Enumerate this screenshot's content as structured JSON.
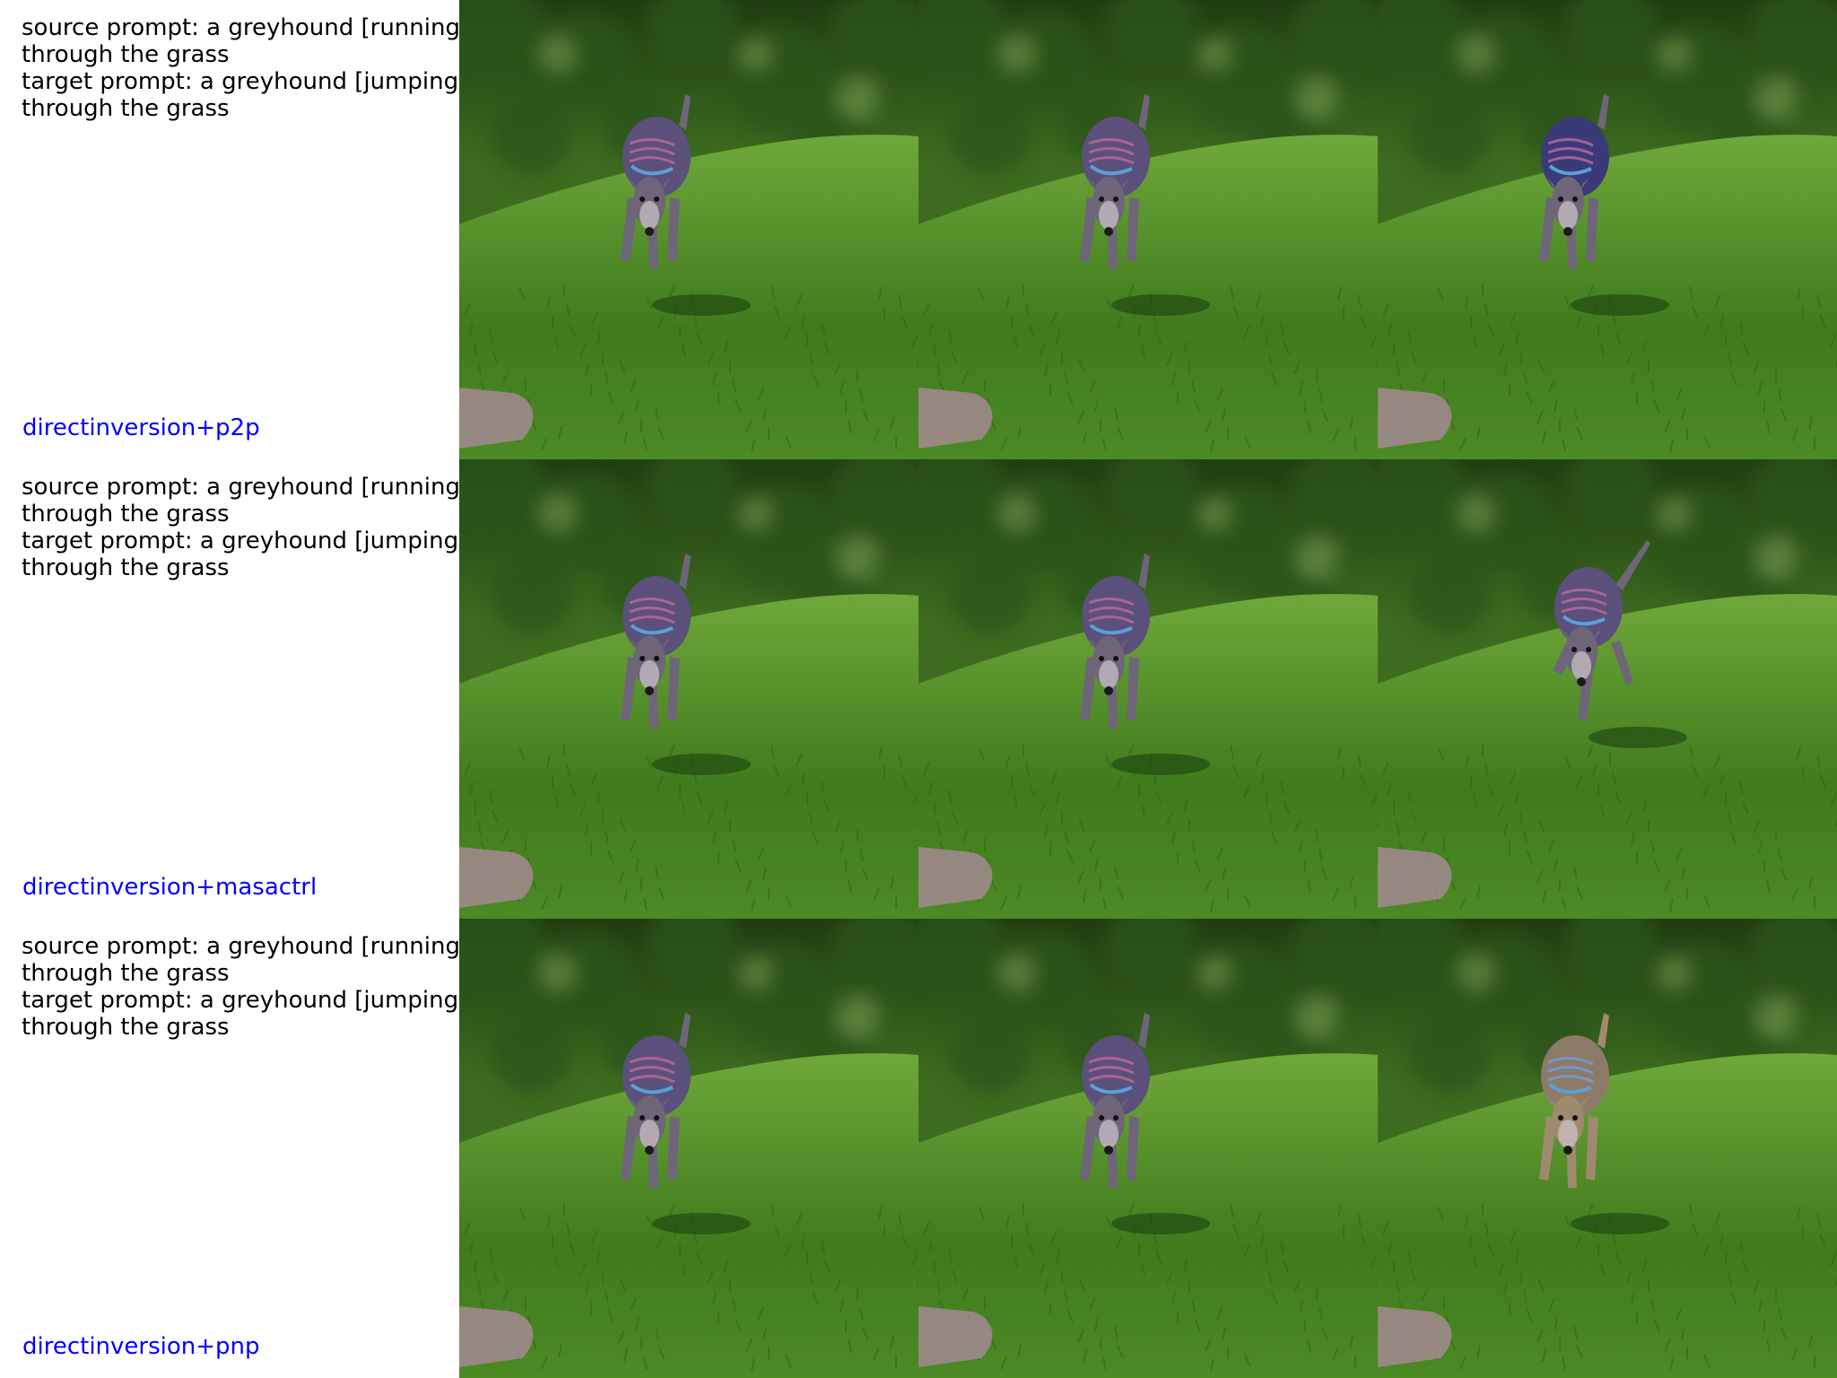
{
  "rows": [
    {
      "source_prompt_1": "source prompt: a greyhound [running]",
      "source_prompt_2": "through the grass",
      "target_prompt_1": "target prompt: a greyhound [jumping]",
      "target_prompt_2": "through the grass",
      "method": "directinversion+p2p",
      "method_color": "#0000ff"
    },
    {
      "source_prompt_1": "source prompt: a greyhound [running]",
      "source_prompt_2": "through the grass",
      "target_prompt_1": "target prompt: a greyhound [jumping]",
      "target_prompt_2": "through the grass",
      "method": "directinversion+masactrl",
      "method_color": "#0000ff"
    },
    {
      "source_prompt_1": "source prompt: a greyhound [running]",
      "source_prompt_2": "through the grass",
      "target_prompt_1": "target prompt: a greyhound [jumping]",
      "target_prompt_2": "through the grass",
      "method": "directinversion+pnp",
      "method_color": "#0000ff"
    }
  ],
  "images": {
    "subject": "greyhound in striped sweater on grass",
    "background_colors": {
      "foliage_dark": "#1f3d12",
      "foliage_mid": "#3d6b1f",
      "grass_light": "#6fa83a",
      "grass_dark": "#3f7a1d",
      "dog_body": "#6e6579",
      "dog_sweater": "#5b4f7c",
      "dog_tan": "#a08a6e"
    }
  }
}
